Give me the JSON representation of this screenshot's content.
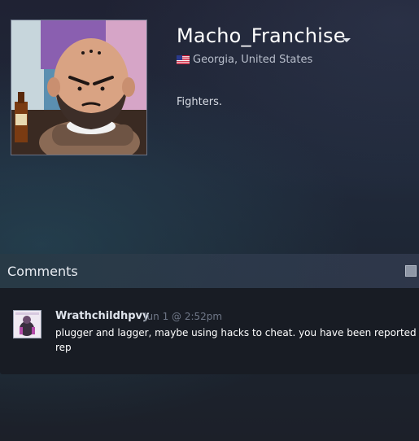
{
  "profile": {
    "persona_name": "Macho_Franchise",
    "location": "Georgia, United States",
    "country_flag": "us-flag-icon",
    "summary": "Fighters.",
    "avatar": "bald-cartoon-avatar"
  },
  "comments": {
    "title": "Comments",
    "items": [
      {
        "author": "Wrathchildhpvy",
        "timestamp": "Jun 1 @ 2:52pm",
        "text_line1": "plugger and lagger, maybe using hacks to cheat. you have been reported f",
        "text_line2": "rep"
      }
    ]
  },
  "colors": {
    "background": "#1f2635",
    "name_text": "#ffffff",
    "muted_text": "#b9bfcc",
    "comment_time": "#6f7787",
    "comments_header": "#2f3d4e",
    "comment_panel": "#181c24"
  }
}
